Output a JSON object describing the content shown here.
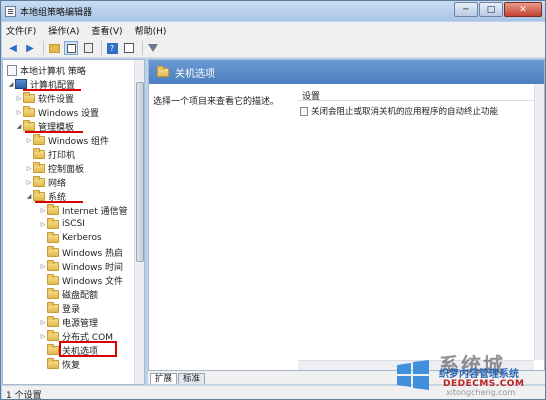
{
  "window": {
    "title": "本地组策略编辑器",
    "minimize": "─",
    "maximize": "□",
    "close": "✕"
  },
  "menu": [
    "文件(F)",
    "操作(A)",
    "查看(V)",
    "帮助(H)"
  ],
  "toolbar": {
    "back_icon": "back-arrow-icon",
    "forward_icon": "forward-arrow-icon"
  },
  "tree": {
    "root": "本地计算机 策略",
    "items": [
      {
        "label": "计算机配置",
        "level": 1,
        "expanded": true,
        "icon": "computer",
        "underlined": true
      },
      {
        "label": "软件设置",
        "level": 2,
        "expanded": false,
        "icon": "folder"
      },
      {
        "label": "Windows 设置",
        "level": 2,
        "expanded": false,
        "icon": "folder"
      },
      {
        "label": "管理模板",
        "level": 2,
        "expanded": true,
        "icon": "folder",
        "underlined": true
      },
      {
        "label": "Windows 组件",
        "level": 3,
        "expanded": false,
        "icon": "folder"
      },
      {
        "label": "打印机",
        "level": 3,
        "expanded": null,
        "icon": "folder"
      },
      {
        "label": "控制面板",
        "level": 3,
        "expanded": false,
        "icon": "folder"
      },
      {
        "label": "网络",
        "level": 3,
        "expanded": false,
        "icon": "folder"
      },
      {
        "label": "系统",
        "level": 3,
        "expanded": true,
        "icon": "folder",
        "underlined": true
      },
      {
        "label": "Internet 通信管",
        "level": 4,
        "expanded": false,
        "icon": "folder"
      },
      {
        "label": "iSCSI",
        "level": 4,
        "expanded": false,
        "icon": "folder"
      },
      {
        "label": "Kerberos",
        "level": 4,
        "expanded": null,
        "icon": "folder"
      },
      {
        "label": "Windows 热启",
        "level": 4,
        "expanded": null,
        "icon": "folder"
      },
      {
        "label": "Windows 时间",
        "level": 4,
        "expanded": false,
        "icon": "folder"
      },
      {
        "label": "Windows 文件",
        "level": 4,
        "expanded": null,
        "icon": "folder"
      },
      {
        "label": "磁盘配额",
        "level": 4,
        "expanded": null,
        "icon": "folder"
      },
      {
        "label": "登录",
        "level": 4,
        "expanded": null,
        "icon": "folder"
      },
      {
        "label": "电源管理",
        "level": 4,
        "expanded": false,
        "icon": "folder"
      },
      {
        "label": "分布式 COM",
        "level": 4,
        "expanded": false,
        "icon": "folder"
      },
      {
        "label": "关机选项",
        "level": 4,
        "expanded": null,
        "icon": "folder",
        "boxed": true
      },
      {
        "label": "恢复",
        "level": 4,
        "expanded": null,
        "icon": "folder"
      }
    ]
  },
  "detail": {
    "header": "关机选项",
    "description": "选择一个项目来查看它的描述。",
    "column": "设置",
    "rows": [
      "关闭会阻止或取消关机的应用程序的自动终止功能"
    ]
  },
  "tabs": [
    "扩展",
    "标准"
  ],
  "status": "1 个设置",
  "watermark": {
    "brand": "系统城",
    "cn": "织梦内容管理系统",
    "en": "DEDECMS.COM",
    "site": "xitongcheng.com"
  },
  "colors": {
    "accent_red": "#d80000",
    "header_blue": "#4d7fbf",
    "folder": "#e2b94f"
  }
}
